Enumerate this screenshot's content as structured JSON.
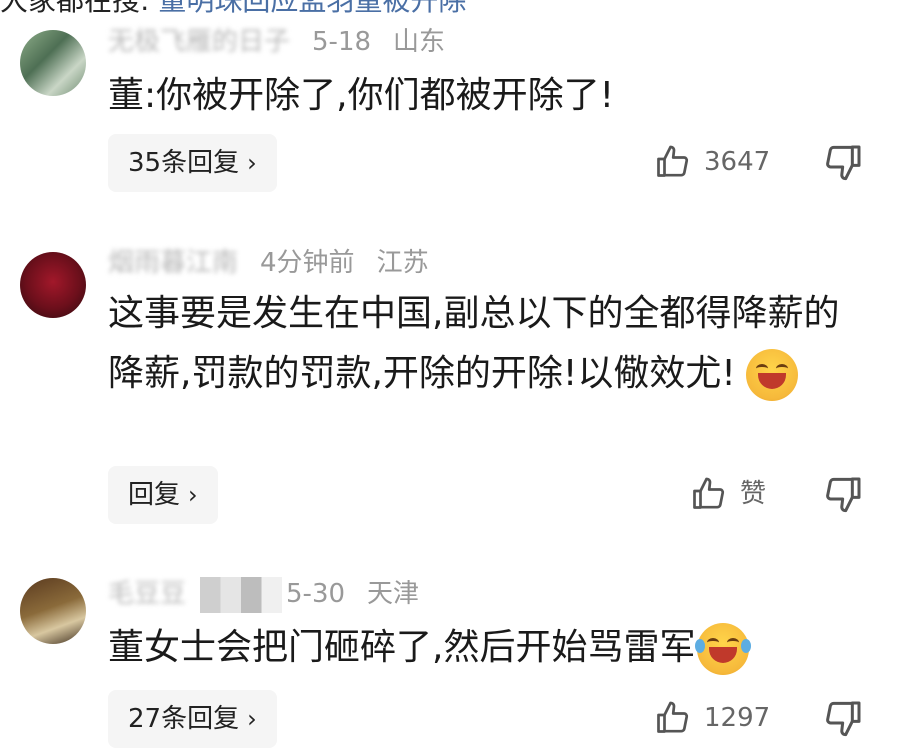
{
  "top_fragment": {
    "dark_text": "大家都在搜:",
    "blue_text": "董明珠回应孟羽童被开除"
  },
  "comments": [
    {
      "username": "无极飞雁的日子",
      "time": "5-18",
      "location": "山东",
      "text": "董:你被开除了,你们都被开除了!",
      "reply_label": "35条回复",
      "like_count": "3647"
    },
    {
      "username": "烟雨暮江南",
      "time": "4分钟前",
      "location": "江苏",
      "text": "这事要是发生在中国,副总以下的全都得降薪的降薪,罚款的罚款,开除的开除!以儆效尤!",
      "emoji": "laughing-emoji",
      "reply_label": "回复",
      "like_count": "赞"
    },
    {
      "username": "毛豆豆",
      "time": "5-30",
      "location": "天津",
      "text": "董女士会把门砸碎了,然后开始骂雷军",
      "emoji": "crying-laughing-emoji",
      "reply_label": "27条回复",
      "like_count": "1297"
    }
  ],
  "colors": {
    "meta_gray": "#999999",
    "text": "#1a1a1a",
    "reply_bg": "#f5f5f5",
    "link_blue": "#4a6fa5"
  },
  "icons": {
    "chevron": "chevron-right-icon",
    "like": "thumbs-up-icon",
    "dislike": "thumbs-down-icon"
  }
}
